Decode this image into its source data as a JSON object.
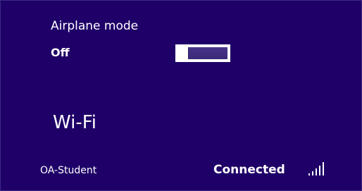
{
  "airplane_mode": {
    "label": "Airplane mode",
    "state": "Off",
    "enabled": false
  },
  "wifi": {
    "title": "Wi-Fi",
    "network": {
      "name": "OA-Student",
      "status": "Connected",
      "signal_icon": "wifi-signal-icon",
      "signal_bars": 5,
      "signal_level": 5
    }
  },
  "colors": {
    "background": "#1f0068",
    "text": "#ffffff",
    "toggle_track": "#4a3389"
  }
}
